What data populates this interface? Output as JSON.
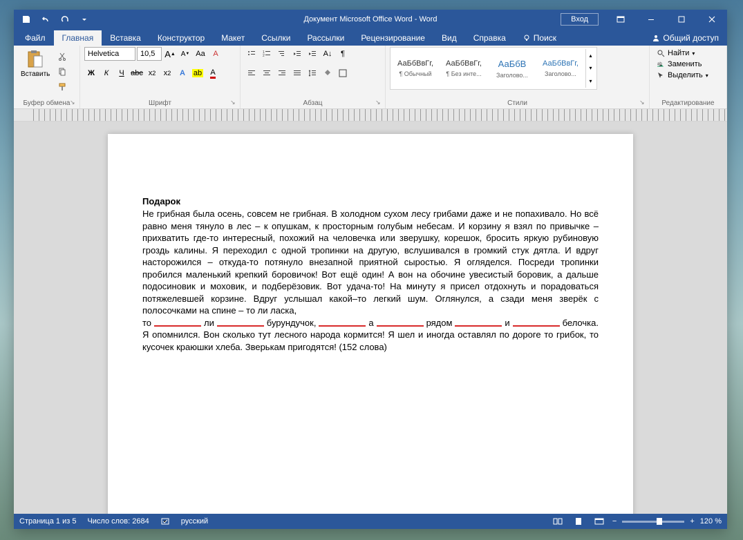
{
  "title": "Документ Microsoft Office Word  -  Word",
  "login": "Вход",
  "tabs": {
    "file": "Файл",
    "home": "Главная",
    "insert": "Вставка",
    "design": "Конструктор",
    "layout": "Макет",
    "references": "Ссылки",
    "mailings": "Рассылки",
    "review": "Рецензирование",
    "view": "Вид",
    "help": "Справка",
    "search": "Поиск",
    "share": "Общий доступ"
  },
  "ribbon": {
    "clipboard": {
      "label": "Буфер обмена",
      "paste": "Вставить"
    },
    "font": {
      "label": "Шрифт",
      "name": "Helvetica",
      "size": "10,5",
      "bold": "Ж",
      "italic": "К",
      "underline": "Ч",
      "strike": "abc"
    },
    "paragraph": {
      "label": "Абзац"
    },
    "styles": {
      "label": "Стили",
      "preview": "АаБбВвГг,",
      "preview2": "АаБбВ",
      "items": [
        "¶ Обычный",
        "¶ Без инте...",
        "Заголово...",
        "Заголово..."
      ]
    },
    "editing": {
      "label": "Редактирование",
      "find": "Найти",
      "replace": "Заменить",
      "select": "Выделить"
    }
  },
  "document": {
    "heading": "Подарок",
    "p1": "Не грибная была осень, совсем не грибная. В холодном сухом лесу грибами даже и не попахивало. Но всё равно меня тянуло в лес – к опушкам, к просторным голубым небесам. И корзину я взял по привычке – прихватить где-то интересный, похожий на человечка или зверушку, корешок, бросить яркую рубиновую гроздь калины. Я переходил с одной тропинки на другую, вслушивался в громкий стук дятла. И вдруг насторожился – откуда-то потянуло внезапной приятной сыростью. Я огляделся. Посреди тропинки пробился маленький крепкий боровичок! Вот ещё один! А вон на обочине увесистый боровик, а дальше подосиновик и моховик, и подберёзовик. Вот удача-то! На минуту я присел отдохнуть и порадоваться потяжелевшей корзине. Вдруг услышал какой–то легкий шум. Оглянулся, а сзади меня зверёк с полосочками на спине – то ли ласка,",
    "blanks": {
      "w1": "то",
      "w2": "ли",
      "w3": "бурундучок,",
      "w4": "а",
      "w5": "рядом",
      "w6": "и",
      "w7": "белочка."
    },
    "p2": "Я опомнился. Вон сколько тут лесного народа кормится! Я шел и иногда оставлял по дороге то грибок, то кусочек краюшки хлеба. Зверькам пригодятся! (152 слова)"
  },
  "status": {
    "page": "Страница 1 из 5",
    "words": "Число слов: 2684",
    "lang": "русский",
    "zoom": "120 %"
  }
}
